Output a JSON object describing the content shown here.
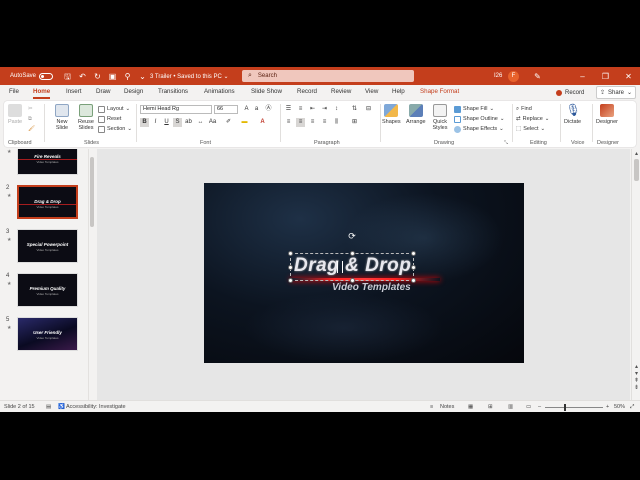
{
  "titlebar": {
    "autosave_label": "AutoSave",
    "toggle_state": "Off",
    "doc_title": "3 Trailer • Saved to this PC ⌄",
    "search_placeholder": "Search",
    "user_initials": "F",
    "user_code": "I26",
    "accent": "#c43e1c"
  },
  "tabs": [
    {
      "label": "File"
    },
    {
      "label": "Home"
    },
    {
      "label": "Insert"
    },
    {
      "label": "Draw"
    },
    {
      "label": "Design"
    },
    {
      "label": "Transitions"
    },
    {
      "label": "Animations"
    },
    {
      "label": "Slide Show"
    },
    {
      "label": "Record"
    },
    {
      "label": "Review"
    },
    {
      "label": "View"
    },
    {
      "label": "Help"
    },
    {
      "label": "Shape Format"
    }
  ],
  "record_label": "Record",
  "share_label": "Share",
  "ribbon": {
    "clipboard": {
      "paste": "Paste",
      "label": "Clipboard"
    },
    "slides": {
      "new_slide": "New Slide",
      "reuse_slides": "Reuse Slides",
      "layout": "Layout",
      "reset": "Reset",
      "section": "Section",
      "label": "Slides"
    },
    "font": {
      "font_name": "Hemi Head Rg",
      "font_size": "66",
      "label": "Font"
    },
    "paragraph": {
      "label": "Paragraph"
    },
    "drawing": {
      "shapes": "Shapes",
      "arrange": "Arrange",
      "quick_styles": "Quick Styles",
      "shape_fill": "Shape Fill",
      "shape_outline": "Shape Outline",
      "shape_effects": "Shape Effects",
      "label": "Drawing"
    },
    "editing": {
      "find": "Find",
      "replace": "Replace",
      "select": "Select",
      "label": "Editing"
    },
    "voice": {
      "dictate": "Dictate",
      "label": "Voice"
    },
    "designer": {
      "designer": "Designer",
      "label": "Designer"
    }
  },
  "thumbnails": [
    {
      "num": "1",
      "title": "Fire Reveals",
      "sub": "Video Templates"
    },
    {
      "num": "2",
      "title": "Drag & Drop",
      "sub": "Video Templates"
    },
    {
      "num": "3",
      "title": "Special Powerpoint",
      "sub": "Video Templates"
    },
    {
      "num": "4",
      "title": "Premium Quality",
      "sub": "Video Templates"
    },
    {
      "num": "5",
      "title": "User Friendly",
      "sub": "Video Templates"
    },
    {
      "num": "6",
      "title": "",
      "sub": ""
    }
  ],
  "slide": {
    "title": "Drag & Drop",
    "subtitle": "Video Templates"
  },
  "statusbar": {
    "slide_info": "Slide 2 of 15",
    "accessibility": "Accessibility: Investigate",
    "notes": "Notes",
    "zoom": "50%"
  }
}
